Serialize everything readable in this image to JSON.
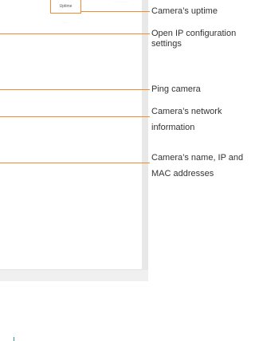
{
  "screen": {
    "uptime_tab_label": "Uptime",
    "faint_top_text": "··· ·· ·······",
    "faint_below_text": "··· ··"
  },
  "callouts": [
    {
      "id": "uptime",
      "text": "Camera’s uptime"
    },
    {
      "id": "ip_config",
      "text": "Open IP configuration settings"
    },
    {
      "id": "ping",
      "text": "Ping camera"
    },
    {
      "id": "network_info",
      "text": "Camera’s network information"
    },
    {
      "id": "name_ip_mac",
      "text": "Camera’s name, IP and MAC addresses"
    }
  ],
  "colors": {
    "accent": "#f28b2d",
    "teal_mark": "#2a9d8f"
  }
}
